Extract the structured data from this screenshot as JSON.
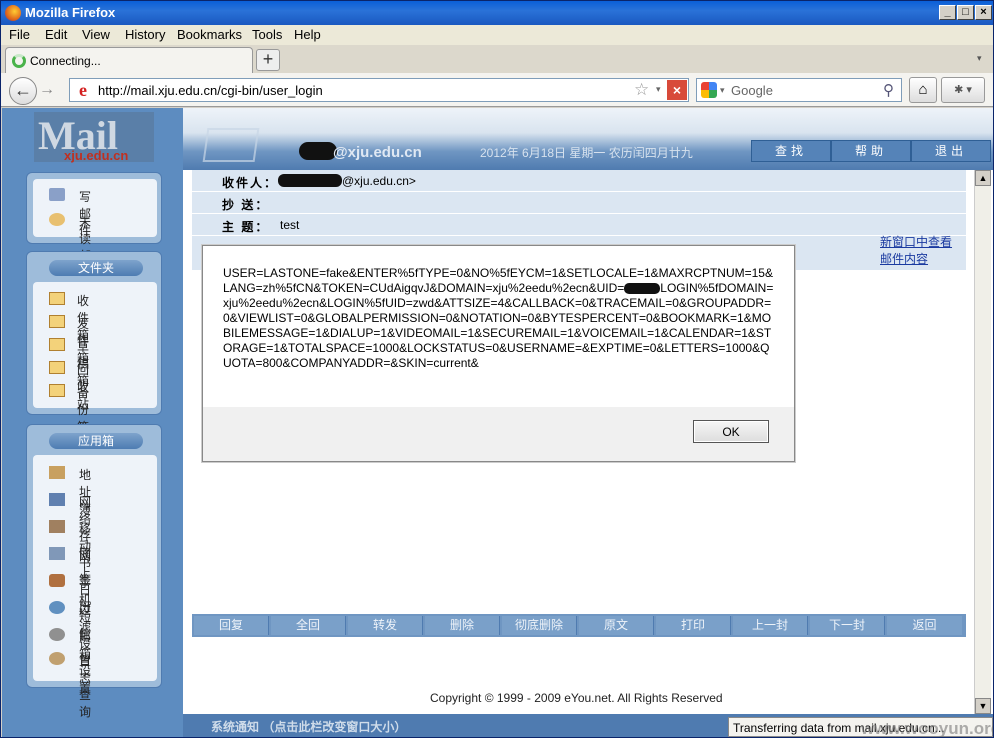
{
  "window": {
    "title": "Mozilla Firefox"
  },
  "menu": [
    "File",
    "Edit",
    "View",
    "History",
    "Bookmarks",
    "Tools",
    "Help"
  ],
  "tab": {
    "label": "Connecting..."
  },
  "nav": {
    "url": "http://mail.xju.edu.cn/cgi-bin/user_login",
    "search_placeholder": "Google"
  },
  "logo": {
    "main": "Mail",
    "sub": "xju.edu.cn"
  },
  "folders_title": "文件夹",
  "apps_title": "应用箱",
  "mail_actions": [
    {
      "label": "写 邮 件"
    },
    {
      "label": "未读邮件"
    }
  ],
  "folders": [
    {
      "label": "收件箱"
    },
    {
      "label": "发件箱"
    },
    {
      "label": "草稿箱"
    },
    {
      "label": "回收站"
    },
    {
      "label": "备份箱"
    }
  ],
  "apps": [
    {
      "label": "地 址 簿"
    },
    {
      "label": "网络存储"
    },
    {
      "label": "移动书签"
    },
    {
      "label": "网上日历"
    },
    {
      "label": "手机短信"
    },
    {
      "label": "过滤设置"
    },
    {
      "label": "邮箱设置"
    },
    {
      "label": "日志查询"
    }
  ],
  "top": {
    "address": "@xju.edu.cn",
    "date": "2012年 6月18日  星期一  农历闰四月廿九",
    "buttons": [
      "查找",
      "帮助",
      "退出"
    ]
  },
  "header": {
    "to_label": "收件人：",
    "to_value": "@xju.edu.cn>",
    "cc_label": "抄  送：",
    "cc_value": "",
    "subject_label": "主  题：",
    "subject_value": "test",
    "newwin": "新窗口中查看邮件内容"
  },
  "actions": [
    "回复",
    "全回",
    "转发",
    "删除",
    "彻底删除",
    "原文",
    "打印",
    "上一封",
    "下一封",
    "返回"
  ],
  "copyright": "Copyright © 1999 - 2009 eYou.net. All Rights Reserved",
  "notice": "系统通知 （点击此栏改变窗口大小）",
  "status": "Transferring data from mail.xju.edu.cn...",
  "watermark": "www.wooyun.org",
  "dialog": {
    "message_pre": "USER=LASTONE=fake&ENTER%5fTYPE=0&NO%5fEYCM=1&SETLOCALE=1&MAXRCPTNUM=15&LANG=zh%5fCN&TOKEN=CUdAigqvJ&DOMAIN=xju%2eedu%2ecn&UID=",
    "message_post": "LOGIN%5fDOMAIN=xju%2eedu%2ecn&LOGIN%5fUID=zwd&ATTSIZE=4&CALLBACK=0&TRACEMAIL=0&GROUPADDR=0&VIEWLIST=0&GLOBALPERMISSION=0&NOTATION=0&BYTESPERCENT=0&BOOKMARK=1&MOBILEMESSAGE=1&DIALUP=1&VIDEOMAIL=1&SECUREMAIL=1&VOICEMAIL=1&CALENDAR=1&STORAGE=1&TOTALSPACE=1000&LOCKSTATUS=0&USERNAME=&EXPTIME=0&LETTERS=1000&QUOTA=800&COMPANYADDR=&SKIN=current&",
    "ok_label": "OK"
  }
}
